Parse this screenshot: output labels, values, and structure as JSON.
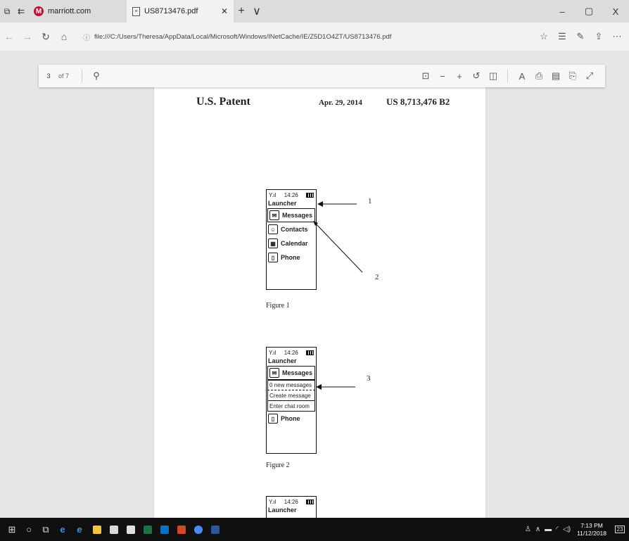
{
  "tabs": [
    {
      "title": "marriott.com",
      "active": false
    },
    {
      "title": "US8713476.pdf",
      "active": true
    }
  ],
  "tabbar": {
    "new_tab_icon": "+",
    "more_icon": "∨"
  },
  "window": {
    "minimize": "–",
    "restore": "▢",
    "close": "X"
  },
  "address": {
    "url": "file:///C:/Users/Theresa/AppData/Local/Microsoft/Windows/INetCache/IE/Z5D1O4ZT/US8713476.pdf"
  },
  "pdf_toolbar": {
    "page": "3",
    "of_pages": "of 7"
  },
  "document": {
    "header_left": "U.S. Patent",
    "header_date": "Apr. 29, 2014",
    "header_number": "US 8,713,476 B2",
    "figures": [
      {
        "caption": "Figure 1",
        "time": "14:26",
        "title": "Launcher",
        "items": [
          "Messages",
          "Contacts",
          "Calendar",
          "Phone"
        ],
        "callouts": [
          "1",
          "2"
        ]
      },
      {
        "caption": "Figure 2",
        "time": "14:26",
        "title": "Launcher",
        "items": [
          "Messages",
          "Phone"
        ],
        "submenu": [
          "0 new messages",
          "Create message",
          "Enter chat room"
        ],
        "callouts": [
          "3"
        ]
      },
      {
        "time": "14:26",
        "title": "Launcher"
      }
    ]
  },
  "taskbar": {
    "clock_time": "7:13 PM",
    "clock_date": "11/12/2018",
    "notification_count": "23"
  }
}
